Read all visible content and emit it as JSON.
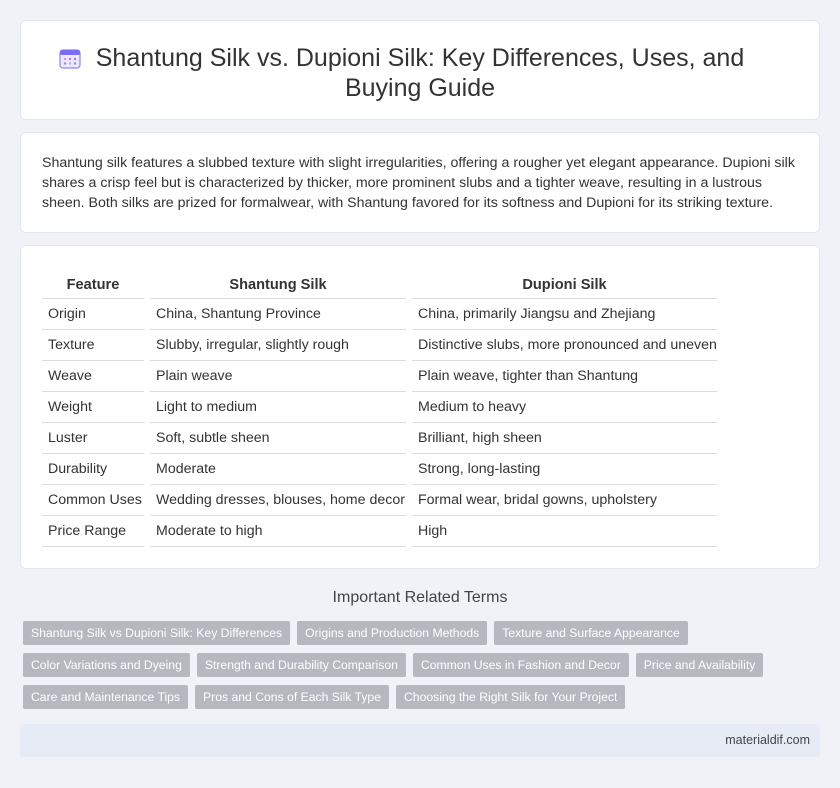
{
  "header": {
    "title": "Shantung Silk vs. Dupioni Silk: Key Differences, Uses, and Buying Guide",
    "icon": "calendar-icon"
  },
  "intro": "Shantung silk features a slubbed texture with slight irregularities, offering a rougher yet elegant appearance. Dupioni silk shares a crisp feel but is characterized by thicker, more prominent slubs and a tighter weave, resulting in a lustrous sheen. Both silks are prized for formalwear, with Shantung favored for its softness and Dupioni for its striking texture.",
  "table": {
    "headers": [
      "Feature",
      "Shantung Silk",
      "Dupioni Silk"
    ],
    "rows": [
      [
        "Origin",
        "China, Shantung Province",
        "China, primarily Jiangsu and Zhejiang"
      ],
      [
        "Texture",
        "Slubby, irregular, slightly rough",
        "Distinctive slubs, more pronounced and uneven"
      ],
      [
        "Weave",
        "Plain weave",
        "Plain weave, tighter than Shantung"
      ],
      [
        "Weight",
        "Light to medium",
        "Medium to heavy"
      ],
      [
        "Luster",
        "Soft, subtle sheen",
        "Brilliant, high sheen"
      ],
      [
        "Durability",
        "Moderate",
        "Strong, long-lasting"
      ],
      [
        "Common Uses",
        "Wedding dresses, blouses, home decor",
        "Formal wear, bridal gowns, upholstery"
      ],
      [
        "Price Range",
        "Moderate to high",
        "High"
      ]
    ]
  },
  "related": {
    "heading": "Important Related Terms",
    "rows": [
      [
        "Shantung Silk vs Dupioni Silk: Key Differences",
        "Origins and Production Methods",
        "Texture and Surface Appearance"
      ],
      [
        "Color Variations and Dyeing",
        "Strength and Durability Comparison",
        "Common Uses in Fashion and Decor",
        "Price and Availability"
      ],
      [
        "Care and Maintenance Tips",
        "Pros and Cons of Each Silk Type",
        "Choosing the Right Silk for Your Project"
      ]
    ]
  },
  "footer": {
    "site": "materialdif.com"
  },
  "colors": {
    "background": "#f0f2f8",
    "tag": "#b5b8bf",
    "footer": "#e6ebf6",
    "icon": "#7c6cf0"
  }
}
